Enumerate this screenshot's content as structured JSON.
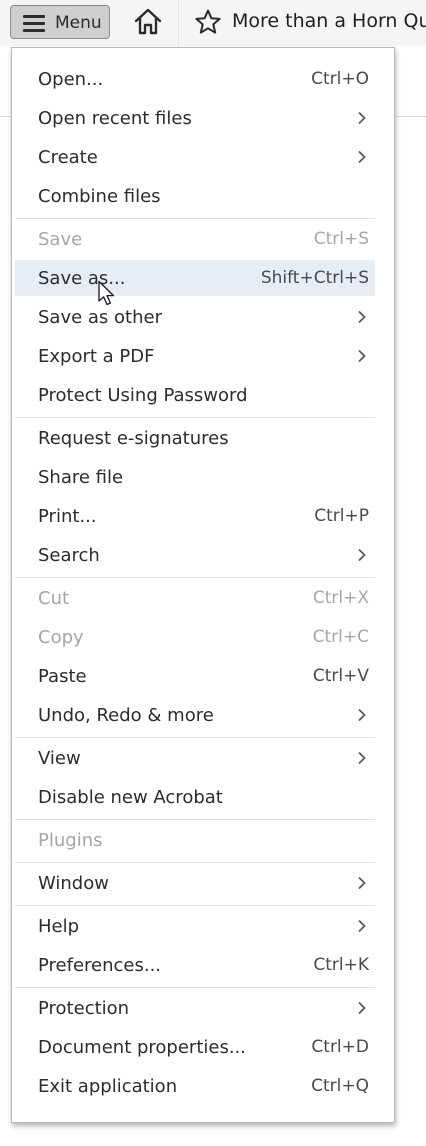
{
  "toolbar": {
    "menu_label": "Menu",
    "document_title": "More than a Horn Quar"
  },
  "menu": {
    "items": [
      {
        "label": "Open...",
        "shortcut": "Ctrl+O",
        "disabled": false
      },
      {
        "label": "Open recent files",
        "submenu": true,
        "disabled": false
      },
      {
        "label": "Create",
        "submenu": true,
        "disabled": false
      },
      {
        "label": "Combine files",
        "disabled": false
      },
      {
        "label": "Save",
        "shortcut": "Ctrl+S",
        "disabled": true
      },
      {
        "label": "Save as...",
        "shortcut": "Shift+Ctrl+S",
        "disabled": false,
        "hovered": true
      },
      {
        "label": "Save as other",
        "submenu": true,
        "disabled": false
      },
      {
        "label": "Export a PDF",
        "submenu": true,
        "disabled": false
      },
      {
        "label": "Protect Using Password",
        "disabled": false
      },
      {
        "label": "Request e-signatures",
        "disabled": false
      },
      {
        "label": "Share file",
        "disabled": false
      },
      {
        "label": "Print...",
        "shortcut": "Ctrl+P",
        "disabled": false
      },
      {
        "label": "Search",
        "submenu": true,
        "disabled": false
      },
      {
        "label": "Cut",
        "shortcut": "Ctrl+X",
        "disabled": true
      },
      {
        "label": "Copy",
        "shortcut": "Ctrl+C",
        "disabled": true
      },
      {
        "label": "Paste",
        "shortcut": "Ctrl+V",
        "disabled": false
      },
      {
        "label": "Undo, Redo & more",
        "submenu": true,
        "disabled": false
      },
      {
        "label": "View",
        "submenu": true,
        "disabled": false
      },
      {
        "label": "Disable new Acrobat",
        "disabled": false
      },
      {
        "label": "Plugins",
        "disabled": true
      },
      {
        "label": "Window",
        "submenu": true,
        "disabled": false
      },
      {
        "label": "Help",
        "submenu": true,
        "disabled": false
      },
      {
        "label": "Preferences...",
        "shortcut": "Ctrl+K",
        "disabled": false
      },
      {
        "label": "Protection",
        "submenu": true,
        "disabled": false
      },
      {
        "label": "Document properties...",
        "shortcut": "Ctrl+D",
        "disabled": false
      },
      {
        "label": "Exit application",
        "shortcut": "Ctrl+Q",
        "disabled": false
      }
    ]
  },
  "colors": {
    "hover_bg": "#e6edf5",
    "disabled_text": "#a6a6a6",
    "menu_button_bg": "#cfcfcf"
  },
  "icons": {
    "menu": "hamburger-icon",
    "home": "home-icon",
    "favorite": "star-icon",
    "submenu": "chevron-right-icon",
    "pointer": "mouse-cursor-icon"
  }
}
